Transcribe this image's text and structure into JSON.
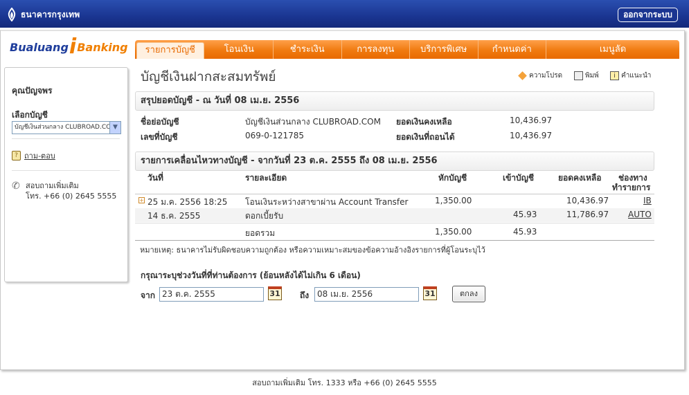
{
  "header": {
    "bank_name": "ธนาคารกรุงเทพ",
    "logout_label": "ออกจากระบบ"
  },
  "brand": {
    "part1": "Bualuang",
    "part_i": "i",
    "part2": "Banking"
  },
  "nav": {
    "items": [
      {
        "label": "รายการบัญชี",
        "active": true
      },
      {
        "label": "โอนเงิน"
      },
      {
        "label": "ชำระเงิน"
      },
      {
        "label": "การลงทุน"
      },
      {
        "label": "บริการพิเศษ"
      },
      {
        "label": "กำหนดค่า"
      },
      {
        "label": "เมนูลัด"
      }
    ]
  },
  "sidebar": {
    "customer_name": "คุณปัญจพร",
    "select_label": "เลือกบัญชี",
    "selected_account": "บัญชีเงินส่วนกลาง CLUBROAD.COM",
    "faq_label": "ถาม-ตอบ",
    "contact_line1": "สอบถามเพิ่มเติม",
    "contact_line2": "โทร. +66 (0) 2645 5555"
  },
  "page": {
    "title": "บัญชีเงินฝากสะสมทรัพย์",
    "tools": {
      "favorite": "ความโปรด",
      "print": "พิมพ์",
      "help": "คำแนะนำ"
    }
  },
  "summary": {
    "heading": "สรุปยอดบัญชี - ณ วันที่ 08 เม.ย. 2556",
    "short_name_label": "ชื่อย่อบัญชี",
    "short_name_value": "บัญชีเงินส่วนกลาง CLUBROAD.COM",
    "account_no_label": "เลขที่บัญชี",
    "account_no_value": "069-0-121785",
    "balance_label": "ยอดเงินคงเหลือ",
    "balance_value": "10,436.97",
    "available_label": "ยอดเงินที่ถอนได้",
    "available_value": "10,436.97"
  },
  "transactions": {
    "heading": "รายการเคลื่อนไหวทางบัญชี - จากวันที่ 23 ต.ค. 2555 ถึง 08 เม.ย. 2556",
    "columns": {
      "date": "วันที่",
      "detail": "รายละเอียด",
      "debit": "หักบัญชี",
      "credit": "เข้าบัญชี",
      "balance": "ยอดคงเหลือ",
      "channel_1": "ช่องทาง",
      "channel_2": "ทำรายการ"
    },
    "rows": [
      {
        "date": "25 ม.ค. 2556 18:25",
        "detail": "โอนเงินระหว่างสาขาผ่าน Account Transfer",
        "debit": "1,350.00",
        "credit": "",
        "balance": "10,436.97",
        "channel": "IB"
      },
      {
        "date": "14 ธ.ค. 2555",
        "detail": "ดอกเบี้ยรับ",
        "debit": "",
        "credit": "45.93",
        "balance": "11,786.97",
        "channel": "AUTO"
      }
    ],
    "total": {
      "label": "ยอดรวม",
      "debit": "1,350.00",
      "credit": "45.93"
    },
    "note": "หมายเหตุ: ธนาคารไม่รับผิดชอบความถูกต้อง หรือความเหมาะสมของข้อความอ้างอิงรายการที่ผู้โอนระบุไว้"
  },
  "date_range": {
    "title": "กรุณาระบุช่วงวันที่ที่ท่านต้องการ  (ย้อนหลังได้ไม่เกิน 6 เดือน)",
    "from_label": "จาก",
    "from_value": "23 ต.ค. 2555",
    "to_label": "ถึง",
    "to_value": "08 เม.ย. 2556",
    "calendar_day": "31",
    "ok_label": "ตกลง"
  },
  "footer": {
    "text": "สอบถามเพิ่มเติม โทร. 1333 หรือ +66 (0) 2645 5555"
  },
  "colors": {
    "top_bar": "#1a3591",
    "nav_orange": "#f07a10",
    "brand_blue": "#1f3e9c",
    "brand_orange": "#f07f00"
  }
}
